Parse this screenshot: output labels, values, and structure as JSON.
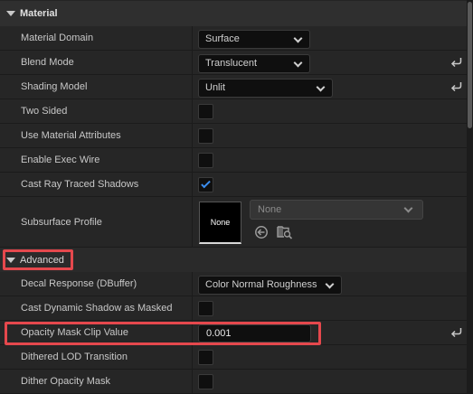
{
  "material_category": {
    "title": "Material"
  },
  "properties": {
    "material_domain": {
      "label": "Material Domain",
      "value": "Surface"
    },
    "blend_mode": {
      "label": "Blend Mode",
      "value": "Translucent"
    },
    "shading_model": {
      "label": "Shading Model",
      "value": "Unlit"
    },
    "two_sided": {
      "label": "Two Sided",
      "checked": false
    },
    "use_material_attributes": {
      "label": "Use Material Attributes",
      "checked": false
    },
    "enable_exec_wire": {
      "label": "Enable Exec Wire",
      "checked": false
    },
    "cast_ray_traced_shadows": {
      "label": "Cast Ray Traced Shadows",
      "checked": true
    },
    "subsurface_profile": {
      "label": "Subsurface Profile",
      "thumbnail_text": "None",
      "asset_value": "None"
    }
  },
  "advanced_category": {
    "title": "Advanced"
  },
  "advanced": {
    "decal_response": {
      "label": "Decal Response (DBuffer)",
      "value": "Color Normal Roughness"
    },
    "cast_dynamic_shadow_as_masked": {
      "label": "Cast Dynamic Shadow as Masked",
      "checked": false
    },
    "opacity_mask_clip_value": {
      "label": "Opacity Mask Clip Value",
      "value": "0.001"
    },
    "dithered_lod_transition": {
      "label": "Dithered LOD Transition",
      "checked": false
    },
    "dither_opacity_mask": {
      "label": "Dither Opacity Mask",
      "checked": false
    }
  },
  "colors": {
    "highlight": "#e5484d",
    "checkmark": "#3b8ef0"
  },
  "icons": [
    "expand-arrow-icon",
    "chevron-down-icon",
    "reset-to-default-icon",
    "checkmark-icon",
    "use-selected-asset-icon",
    "browse-asset-icon"
  ]
}
